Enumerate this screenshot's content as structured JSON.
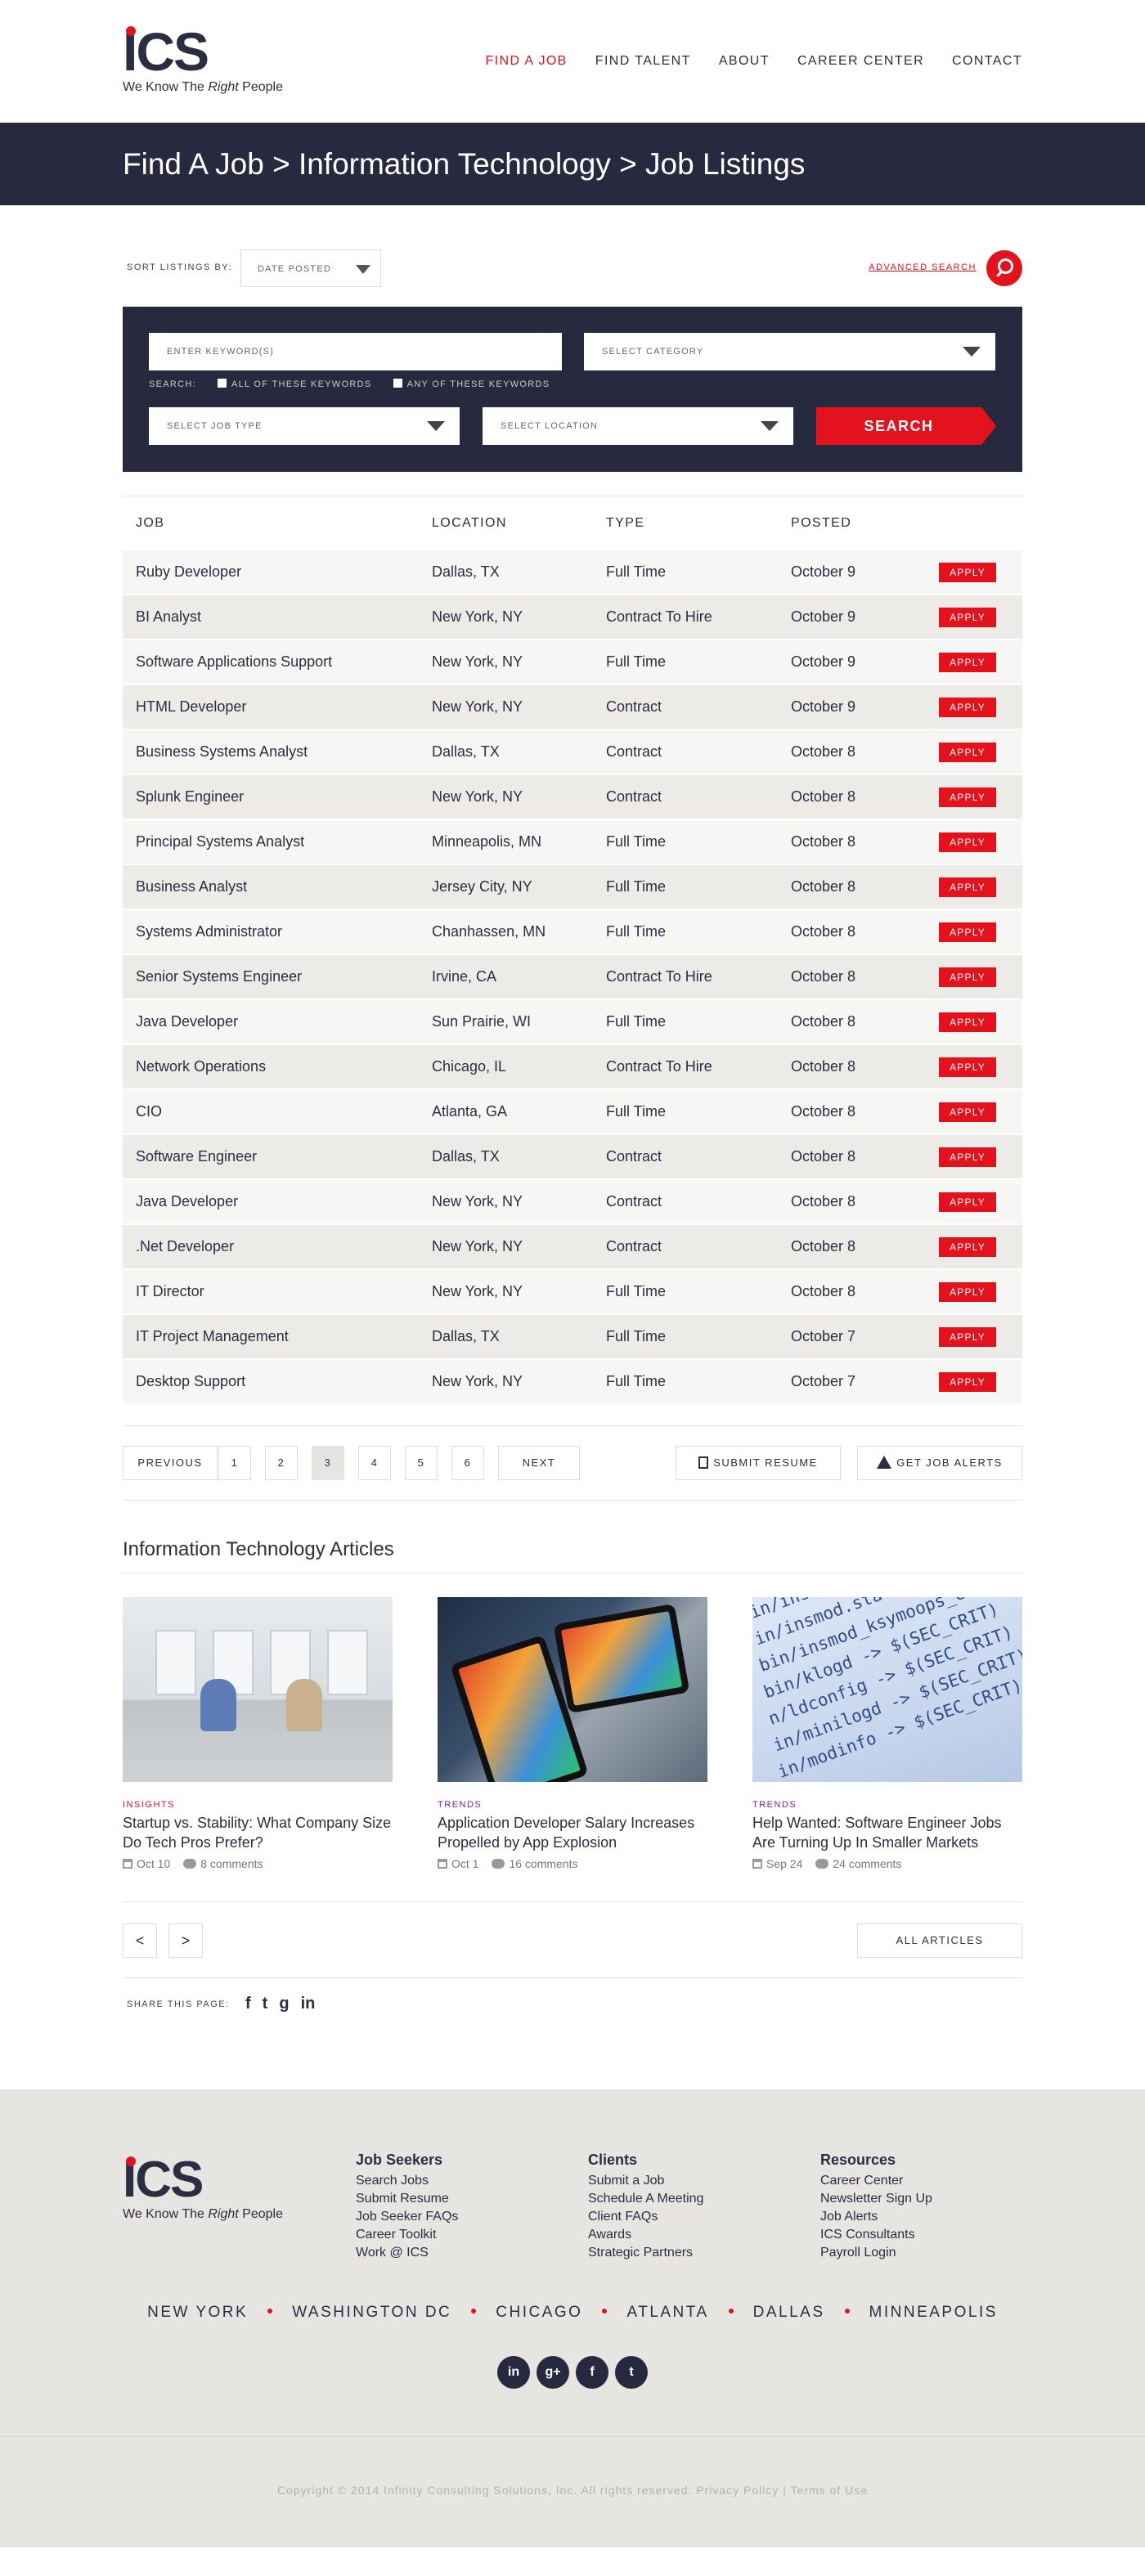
{
  "header": {
    "logo_text": "ICS",
    "tagline_pre": "We Know The ",
    "tagline_em": "Right",
    "tagline_post": " People",
    "nav": [
      "FIND A JOB",
      "FIND TALENT",
      "ABOUT",
      "CAREER CENTER",
      "CONTACT"
    ],
    "active_nav": "FIND A JOB"
  },
  "banner": {
    "title": "Find A Job > Information Technology > Job Listings"
  },
  "sort": {
    "label": "SORT LISTINGS BY:",
    "selected": "DATE POSTED",
    "advanced_search": "ADVANCED SEARCH"
  },
  "search": {
    "keywords_placeholder": "ENTER KEYWORD(S)",
    "category_placeholder": "SELECT CATEGORY",
    "search_label": "SEARCH:",
    "option_all": "ALL OF THESE KEYWORDS",
    "option_any": "ANY OF THESE KEYWORDS",
    "job_type_placeholder": "SELECT JOB TYPE",
    "location_placeholder": "SELECT LOCATION",
    "button": "SEARCH"
  },
  "table": {
    "headers": [
      "JOB",
      "LOCATION",
      "TYPE",
      "POSTED"
    ],
    "apply_label": "APPLY",
    "rows": [
      [
        "Ruby Developer",
        "Dallas, TX",
        "Full Time",
        "October 9"
      ],
      [
        "BI Analyst",
        "New York, NY",
        "Contract To Hire",
        "October 9"
      ],
      [
        "Software Applications Support",
        "New York, NY",
        "Full Time",
        "October 9"
      ],
      [
        "HTML Developer",
        "New York, NY",
        "Contract",
        "October 9"
      ],
      [
        "Business Systems Analyst",
        "Dallas, TX",
        "Contract",
        "October 8"
      ],
      [
        "Splunk Engineer",
        "New York, NY",
        "Contract",
        "October 8"
      ],
      [
        "Principal Systems Analyst",
        "Minneapolis, MN",
        "Full Time",
        "October 8"
      ],
      [
        "Business Analyst",
        "Jersey City, NY",
        "Full Time",
        "October 8"
      ],
      [
        "Systems Administrator",
        "Chanhassen, MN",
        "Full Time",
        "October 8"
      ],
      [
        "Senior Systems Engineer",
        "Irvine, CA",
        "Contract To Hire",
        "October 8"
      ],
      [
        "Java Developer",
        "Sun Prairie, WI",
        "Full Time",
        "October 8"
      ],
      [
        "Network Operations",
        "Chicago, IL",
        "Contract To Hire",
        "October 8"
      ],
      [
        "CIO",
        "Atlanta, GA",
        "Full Time",
        "October 8"
      ],
      [
        "Software Engineer",
        "Dallas, TX",
        "Contract",
        "October 8"
      ],
      [
        "Java Developer",
        "New York, NY",
        "Contract",
        "October 8"
      ],
      [
        ".Net Developer",
        "New York, NY",
        "Contract",
        "October 8"
      ],
      [
        "IT Director",
        "New York, NY",
        "Full Time",
        "October 8"
      ],
      [
        "IT Project Management",
        "Dallas, TX",
        "Full Time",
        "October 7"
      ],
      [
        "Desktop Support",
        "New York, NY",
        "Full Time",
        "October 7"
      ]
    ]
  },
  "pagination": {
    "previous": "PREVIOUS",
    "pages": [
      "1",
      "2",
      "3",
      "4",
      "5",
      "6"
    ],
    "current": "3",
    "next": "NEXT",
    "submit_resume": "SUBMIT RESUME",
    "job_alerts": "GET JOB ALERTS"
  },
  "articles": {
    "title": "Information Technology Articles",
    "items": [
      {
        "tag": "INSIGHTS",
        "title": "Startup vs. Stability: What Company Size Do Tech Pros Prefer?",
        "date": "Oct 10",
        "comments": "8 comments"
      },
      {
        "tag": "TRENDS",
        "title": "Application Developer Salary Increases Propelled by App Explosion",
        "date": "Oct 1",
        "comments": "16 comments"
      },
      {
        "tag": "TRENDS",
        "title": "Help Wanted: Software Engineer Jobs Are Turning Up In Smaller Markets",
        "date": "Sep 24",
        "comments": "24 comments"
      }
    ],
    "code_lines": [
      "in/insmod -> $(SEC_CRIT)",
      "in/insmod.static -> $(SEC_CRIT)",
      "bin/insmod_ksymoops_clean -> $(SEC_C",
      "bin/klogd -> $(SEC_CRIT)",
      "n/ldconfig -> $(SEC_CRIT)",
      "in/minilogd -> $(SEC_CRIT)",
      "in/modinfo -> $(SEC_CRIT)"
    ],
    "prev": "<",
    "next": ">",
    "all": "ALL ARTICLES"
  },
  "share": {
    "label": "SHARE THIS PAGE:",
    "icons": [
      "f",
      "t",
      "g",
      "in"
    ]
  },
  "footer": {
    "columns": [
      {
        "title": "Job Seekers",
        "links": [
          "Search Jobs",
          "Submit Resume",
          "Job Seeker FAQs",
          "Career Toolkit",
          "Work @ ICS"
        ]
      },
      {
        "title": "Clients",
        "links": [
          "Submit a Job",
          "Schedule A Meeting",
          "Client FAQs",
          "Awards",
          "Strategic Partners"
        ]
      },
      {
        "title": "Resources",
        "links": [
          "Career Center",
          "Newsletter Sign Up",
          "Job Alerts",
          "ICS Consultants",
          "Payroll Login"
        ]
      }
    ],
    "cities": [
      "NEW YORK",
      "WASHINGTON DC",
      "CHICAGO",
      "ATLANTA",
      "DALLAS",
      "MINNEAPOLIS"
    ],
    "socials": [
      "in",
      "g+",
      "f",
      "t"
    ],
    "copyright": "Copyright © 2014 Infinity Consulting Solutions, Inc. All rights reserved. Privacy Policy | Terms of Use"
  },
  "colors": {
    "accent": "#e3121d",
    "navy": "#272a3f",
    "footer_bg": "#e6e5e1"
  }
}
